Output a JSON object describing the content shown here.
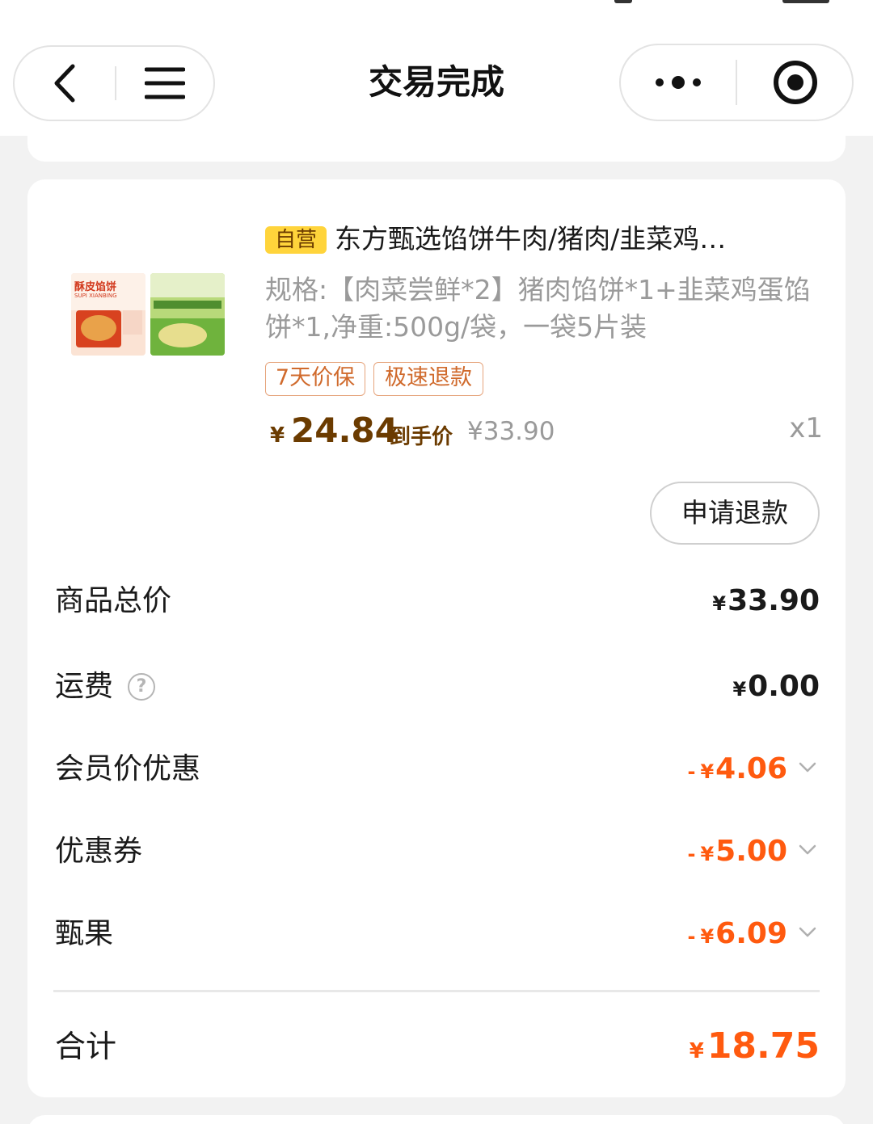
{
  "header": {
    "title": "交易完成"
  },
  "product": {
    "self_tag": "自营",
    "title": "东方甄选馅饼牛肉/猪肉/韭菜鸡…",
    "spec": "规格:【肉菜尝鲜*2】猪肉馅饼*1+韭菜鸡蛋馅饼*1,净重:500g/袋，一袋5片装",
    "badges": [
      "7天价保",
      "极速退款"
    ],
    "price_symbol": "¥",
    "price": "24.84",
    "price_label": "到手价",
    "original_price": "¥33.90",
    "quantity": "x1",
    "image_text_a": "酥皮馅饼",
    "image_text_a_sub": "SUPI XIANBING"
  },
  "refund_button": "申请退款",
  "fees": {
    "currency": "¥",
    "discount_sign": "-",
    "items": [
      {
        "label": "商品总价",
        "value": "33.90"
      },
      {
        "label": "运费",
        "value": "0.00"
      },
      {
        "label": "会员价优惠",
        "value": "4.06"
      },
      {
        "label": "优惠券",
        "value": "5.00"
      },
      {
        "label": "甄果",
        "value": "6.09"
      }
    ]
  },
  "total": {
    "label": "合计",
    "value": "18.75"
  },
  "colors": {
    "accent": "#ff5a0f",
    "price_brown": "#6b3b00",
    "self_tag_bg": "#ffd43b",
    "badge_border": "#e6a57d"
  },
  "icons": [
    "back-arrow-icon",
    "menu-icon",
    "more-dots-icon",
    "close-target-icon",
    "help-circle-icon",
    "chevron-down-icon"
  ]
}
